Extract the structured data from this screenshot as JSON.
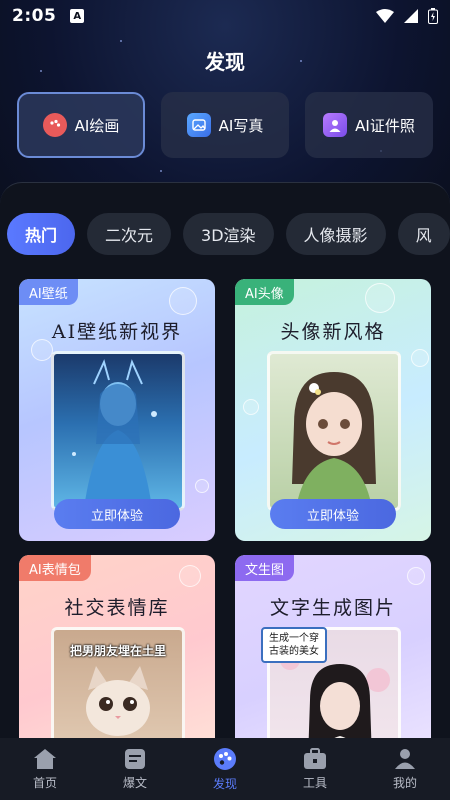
{
  "status_bar": {
    "time": "2:05",
    "app_icon_letter": "A"
  },
  "header": {
    "title": "发现"
  },
  "features": [
    {
      "label": "AI绘画",
      "icon": "palette-icon",
      "color": "#e85a5a",
      "active": true
    },
    {
      "label": "AI写真",
      "icon": "photo-icon",
      "color": "#4a8cf0",
      "active": false
    },
    {
      "label": "AI证件照",
      "icon": "id-photo-icon",
      "color": "#9a5cf0",
      "active": false
    }
  ],
  "categories": [
    "热门",
    "二次元",
    "3D渲染",
    "人像摄影",
    "风"
  ],
  "cards": [
    {
      "badge": "AI壁纸",
      "title": "AI壁纸新视界",
      "cta": "立即体验",
      "badge_color": "#6d8df5"
    },
    {
      "badge": "AI头像",
      "title": "头像新风格",
      "cta": "立即体验",
      "badge_color": "#39b27a"
    },
    {
      "badge": "AI表情包",
      "title": "社交表情库",
      "image_caption": "把男朋友埋在土里",
      "badge_color": "#f07b6a"
    },
    {
      "badge": "文生图",
      "title": "文字生成图片",
      "image_caption": "生成一个穿古装的美女",
      "badge_color": "#8d6af0"
    }
  ],
  "nav": [
    {
      "label": "首页",
      "icon": "home-icon",
      "active": false
    },
    {
      "label": "爆文",
      "icon": "article-icon",
      "active": false
    },
    {
      "label": "发现",
      "icon": "discover-palette-icon",
      "active": true
    },
    {
      "label": "工具",
      "icon": "toolbox-icon",
      "active": false
    },
    {
      "label": "我的",
      "icon": "profile-icon",
      "active": false
    }
  ]
}
